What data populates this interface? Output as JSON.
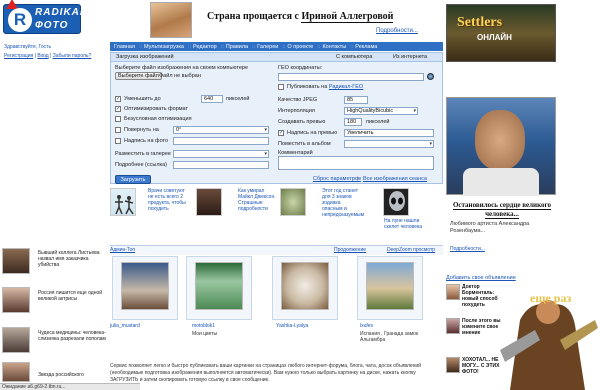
{
  "logo": {
    "letter": "R",
    "line1": "RADIKAL",
    "line2": "ФОТО"
  },
  "header": {
    "title_prefix": "Страна прощается с ",
    "title_name": "Ириной Аллегровой",
    "more_link": "Подробности..."
  },
  "user": {
    "greeting": "Здравствуйте, Гость",
    "links": [
      "Регистрация",
      "Вход",
      "Забыли пароль?"
    ]
  },
  "top_ad": {
    "title": "Settlers",
    "subtitle": "ОНЛАЙН"
  },
  "nav": {
    "items": [
      "Главная",
      "Мультизагрузка",
      "Редактор",
      "Правила",
      "Галереи",
      "О проекте",
      "Контакты",
      "Реклама"
    ]
  },
  "upload": {
    "tab_title": "Загрузка изображений",
    "tab_computer": "С компьютера",
    "tab_internet": "Из интернета",
    "choose_label": "Выберите файл изображения на своем компьютере",
    "choose_button": "Выберите файл",
    "no_file": "Файл не выбран",
    "geo_label": "ГЕО координаты:",
    "geo_publish": "Публиковать на",
    "geo_publish_link": "Радикал-ГЕО",
    "resize_label": "Уменьшить до",
    "resize_value": "640",
    "resize_unit": "пикселей",
    "optimize_label": "Оптимизировать формат",
    "lossless_label": "Безусловная оптимизация",
    "rotate_label": "Повернуть на",
    "rotate_value": "0°",
    "caption_label": "Надпись на фото",
    "gallery_label": "Разместить в галерее",
    "details_label": "Подробнее (ссылка)",
    "jpeg_label": "Качество JPEG",
    "jpeg_value": "85",
    "interp_label": "Интерполяция",
    "interp_value": "HighQualityBicubic",
    "preview_label": "Создавать превью",
    "preview_value": "180",
    "preview_unit": "пикселей",
    "preview_caption_label": "Надпись на превью",
    "preview_caption_value": "Увеличить",
    "album_label": "Поместить в альбом",
    "comment_label": "Комментарий",
    "reset_link": "Сброс параметров",
    "all_sessions_link": "Все изображения сеанса",
    "upload_button": "Загрузить"
  },
  "news": [
    {
      "text": "Врачи советуют не есть всего 2 продукта, чтобы похудеть"
    },
    {
      "text": "Как умирал Майкл Джексон. Страшные подробности"
    },
    {
      "text": "Этот год станет для 3 знаков зодиака опасным и непредсказуемым"
    },
    {
      "text": "На луне нашли скелет человека"
    }
  ],
  "gallery": {
    "left_link": "Админ-Топ",
    "right_links": [
      "Продолжение",
      "DeepZoom просмотр"
    ],
    "items": [
      {
        "user": "julia_mustard",
        "title": ""
      },
      {
        "user": "motoblok1",
        "title": "Мои цветы"
      },
      {
        "user": "Yashka-Lyalya",
        "title": ""
      },
      {
        "user": "lxufes",
        "title": "Испания , Гранада замок Альгамбра"
      }
    ]
  },
  "description": "Сервис позволяет легко и быстро публиковать ваши картинки на страницах любого интернет-форума, блога, чата, досок объявлений (необходимые подготовка изображения выполняется автоматически). Вам нужно только выбрать картинку на диске, нажать кнопку ЗАГРУЗИТЬ и затем скопировать готовую ссылку в свое сообщение.",
  "left_news": [
    "Бывший коллега Листьева назвал имя заказчика убийства",
    "Россия лишится еще одной великой актрисы",
    "Чудеса медицины: человека-слизняка разрезали пополам",
    "Звезда российского"
  ],
  "right": {
    "title": "Остановилось сердце великого человека...",
    "subtitle": "Любимого артиста Александра Розенбаума...",
    "more_link": "Подробности...",
    "ads_header": "Добавить свое объявление",
    "ads": [
      "Доктор Борменталь: новый способ похудеть",
      "После этого вы измените свое мнение",
      "ХОХОТАЛ... НЕ МОГУ... С ЭТИХ ФОТО!"
    ]
  },
  "status_bar": "Ожидание a6.g69-2.tbn.ru..."
}
